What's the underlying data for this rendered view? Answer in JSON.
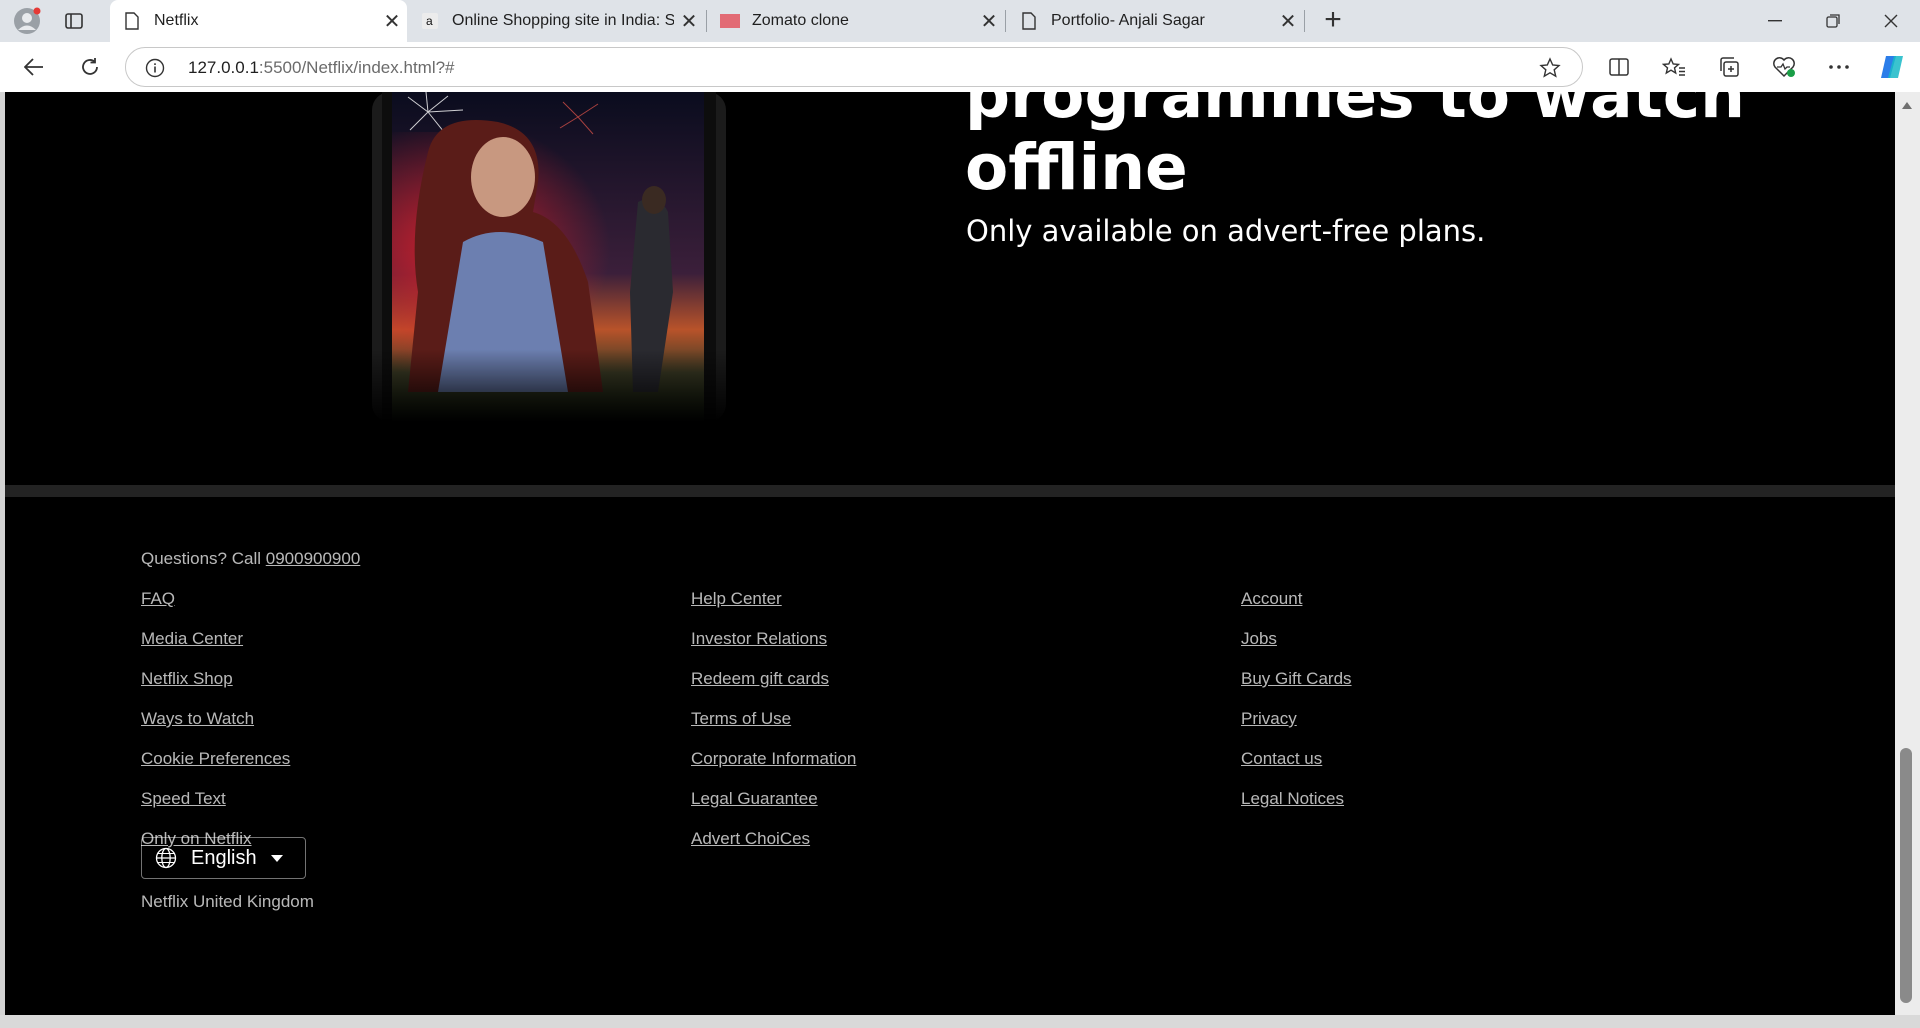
{
  "browser": {
    "tabs": [
      {
        "title": "Netflix",
        "favicon": "page-icon",
        "active": true
      },
      {
        "title": "Online Shopping site in India: Sho",
        "favicon": "amazon-icon",
        "active": false
      },
      {
        "title": "Zomato clone",
        "favicon": "zomato-icon",
        "active": false
      },
      {
        "title": "Portfolio- Anjali Sagar",
        "favicon": "page-icon",
        "active": false
      }
    ],
    "new_tab_label": "+",
    "url_host": "127.0.0.1",
    "url_rest": ":5500/Netflix/index.html?#",
    "colors": {
      "tabbar": "#dfe3e8",
      "active_tab": "#ffffff",
      "copilot": "#2b7de9"
    }
  },
  "hero": {
    "headline_line1": "programmes to watch",
    "headline_line2": "offline",
    "subline": "Only available on advert-free plans."
  },
  "footer": {
    "questions_label": "Questions? Call",
    "phone": "0900900900",
    "columns": [
      [
        "FAQ",
        "Media Center",
        "Netflix Shop",
        "Ways to Watch",
        "Cookie Preferences",
        "Speed Text",
        "Only on Netflix"
      ],
      [
        "Help Center",
        "Investor Relations",
        "Redeem gift cards",
        "Terms of Use",
        "Corporate Information",
        "Legal Guarantee",
        "Advert ChoiCes"
      ],
      [
        "Account",
        "Jobs",
        "Buy Gift Cards",
        "Privacy",
        "Contact us",
        "Legal Notices"
      ]
    ],
    "language": "English",
    "country": "Netflix United Kingdom"
  }
}
